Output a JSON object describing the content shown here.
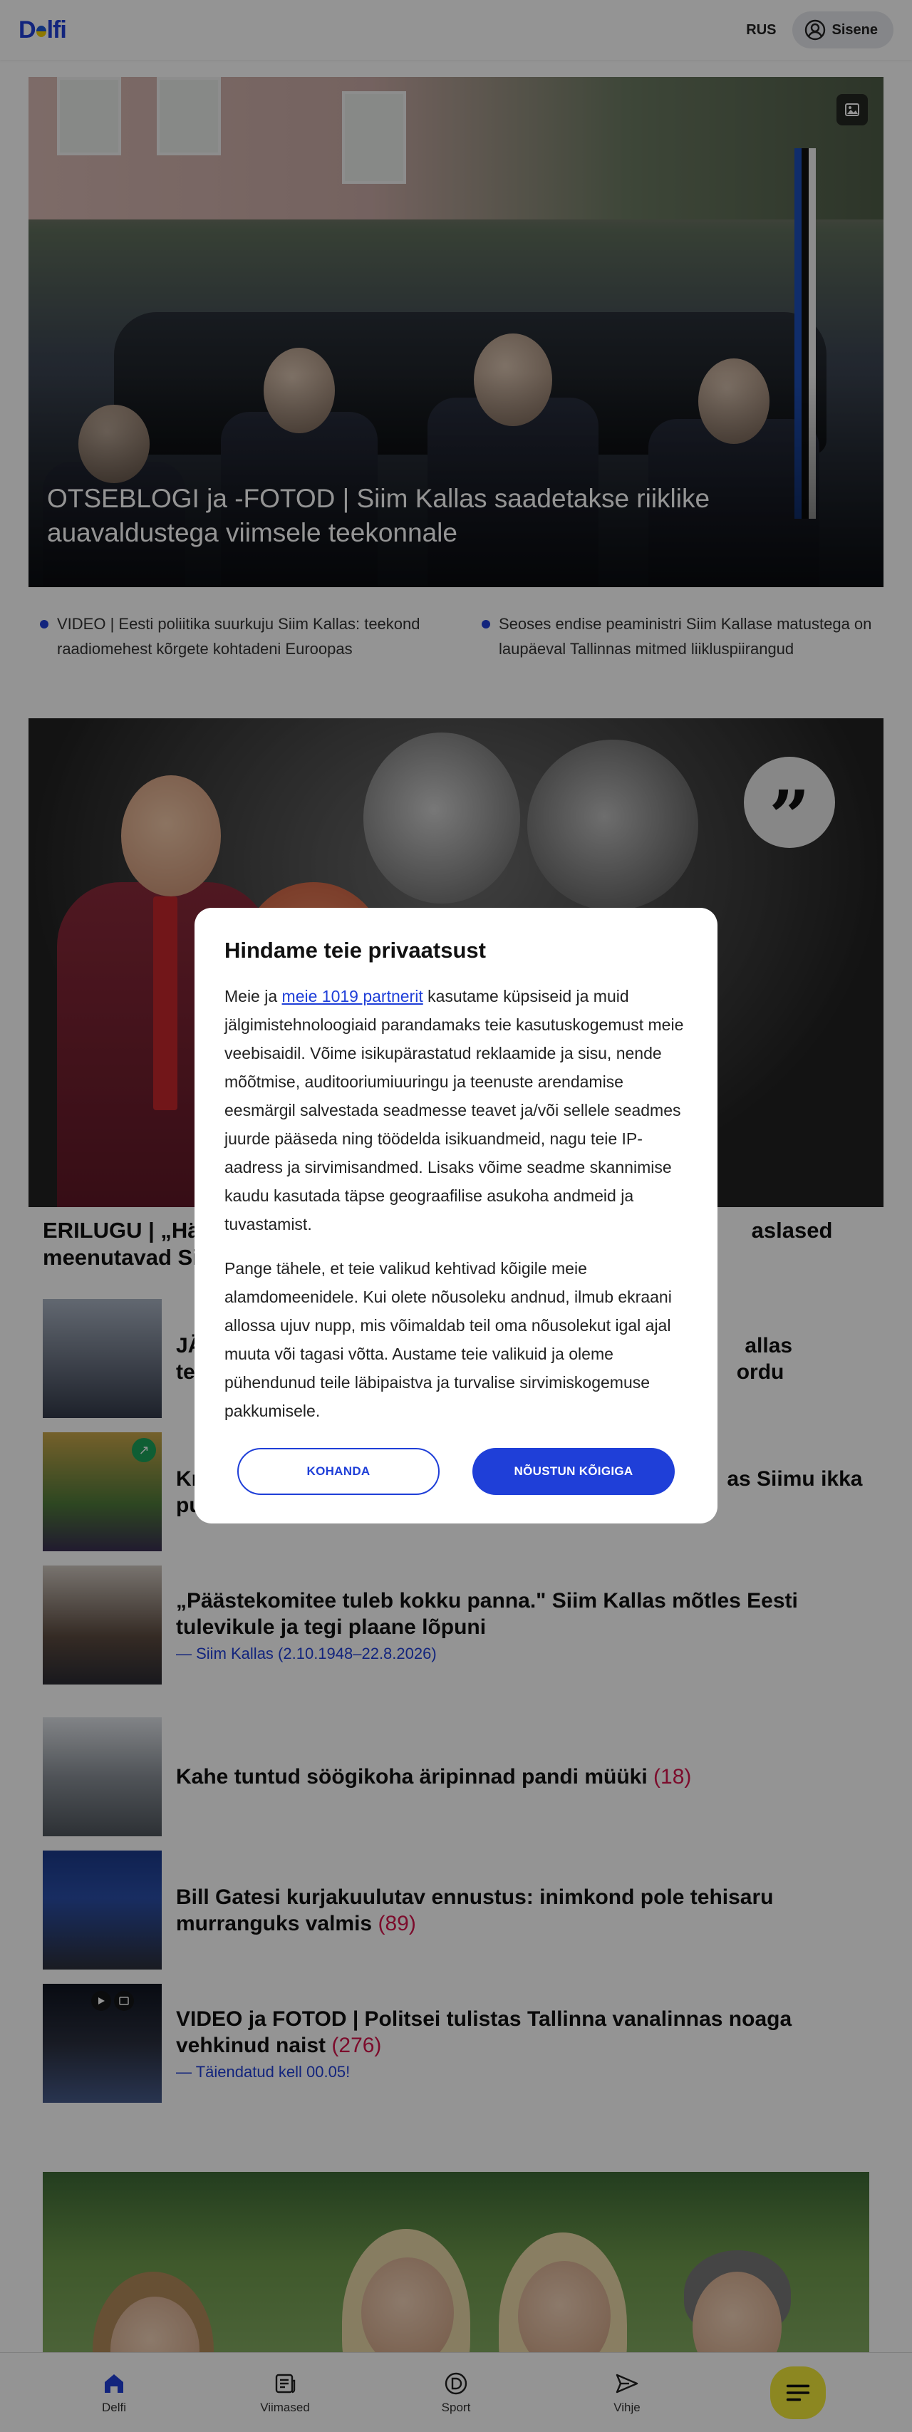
{
  "header": {
    "logo": "Delfi",
    "lang": "RUS",
    "login_label": "Sisene"
  },
  "hero": {
    "title": "OTSEBLOGI ja -FOTOD | Siim Kallas saadetakse riiklike auavaldustega viimsele teekonnale",
    "photo_icon": "image-icon"
  },
  "related": [
    {
      "text": "VIDEO | Eesti poliitika suurkuju Siim Kallas: teekond raadiomehest kõrgete kohtadeni Euroopas"
    },
    {
      "text": "Seoses endise peaministri Siim Kallase matustega on laupäeval Tallinnas mitmed liikluspiirangud"
    }
  ],
  "feature": {
    "title_visible_start": "ERILUGU | „Härr",
    "title_visible_end": "aslased",
    "title_line2_start": "meenutavad Sii"
  },
  "items": [
    {
      "title_start": "JÄ",
      "title_end": "allas",
      "line2_start": "te",
      "line2_end": "ordu"
    },
    {
      "title_start": "Kr",
      "title_end": "as Siimu ikka",
      "line2_start": "pu"
    },
    {
      "title": "„Päästekomitee tuleb kokku panna.\" Siim Kallas mõtles Eesti tulevikule ja tegi plaane lõpuni",
      "sub": "Siim Kallas (2.10.1948–22.8.2026)"
    },
    {
      "title": "Kahe tuntud söögikoha äripinnad pandi müüki",
      "count": "(18)"
    },
    {
      "title": "Bill Gatesi kurjakuulutav ennustus: inimkond pole tehisaru murranguks valmis",
      "count": "(89)"
    },
    {
      "title": "VIDEO ja FOTOD | Politsei tulistas Tallinna vanalinnas noaga vehkinud naist",
      "count": "(276)",
      "sub": "Täiendatud kell 00.05!"
    }
  ],
  "modal": {
    "title": "Hindame teie privaatsust",
    "p1_before": "Meie ja ",
    "p1_link": "meie 1019 partnerit",
    "p1_after": " kasutame küpsiseid ja muid jälgimistehnoloogiaid parandamaks teie kasutuskogemust meie veebisaidil. Võime isikupärastatud reklaamide ja sisu, nende mõõtmise, auditooriumiuuringu ja teenuste arendamise eesmärgil salvestada seadmesse teavet ja/või sellele seadmes juurde pääseda ning töödelda isikuandmeid, nagu teie IP-aadress ja sirvimisandmed. Lisaks võime seadme skannimise kaudu kasutada täpse geograafilise asukoha andmeid ja tuvastamist.",
    "p2": "Pange tähele, et teie valikud kehtivad kõigile meie alamdomeenidele. Kui olete nõusoleku andnud, ilmub ekraani allossa ujuv nupp, mis võimaldab teil oma nõusolekut igal ajal muuta või tagasi võtta. Austame teie valikuid ja oleme pühendunud teile läbipaistva ja turvalise sirvimiskogemuse pakkumisele.",
    "customize_label": "KOHANDA",
    "accept_label": "NÕUSTUN KÕIGIGA"
  },
  "bottom_nav": [
    {
      "label": "Delfi",
      "icon": "home-icon"
    },
    {
      "label": "Viimased",
      "icon": "news-icon"
    },
    {
      "label": "Sport",
      "icon": "sport-icon"
    },
    {
      "label": "Vihje",
      "icon": "send-icon"
    },
    {
      "label": "",
      "icon": "menu-icon"
    }
  ],
  "colors": {
    "brand_blue": "#1f3fd8",
    "comment_count": "#d6154d",
    "menu_yellow": "#f1e93a"
  }
}
